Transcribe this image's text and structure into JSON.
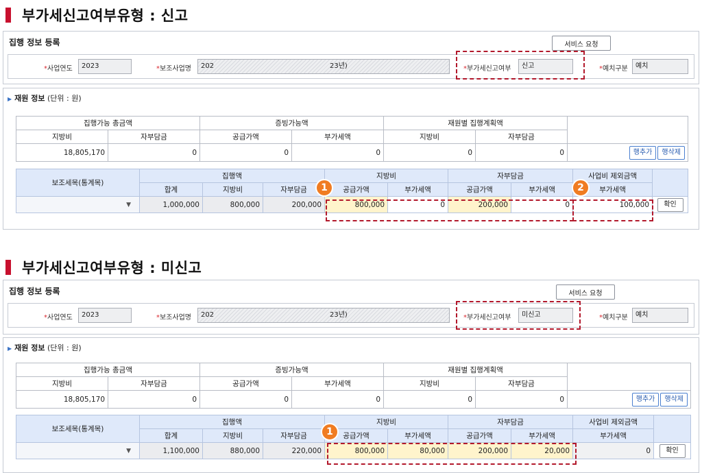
{
  "sections": [
    {
      "headline": "부가세신고여부유형 : 신고",
      "panel_title": "집행 정보 등록",
      "service_button": "서비스 요청",
      "fields": {
        "year_label": "사업연도",
        "year_value": "2023",
        "project_label": "보조사업명",
        "project_value_start": "202",
        "project_value_end": "23년)",
        "vat_label": "부가세신고여부",
        "vat_value": "신고",
        "deposit_label": "예치구분",
        "deposit_value": "예치"
      },
      "fund_title_bold": "재원 정보",
      "fund_title_unit": "(단위 : 원)",
      "summary": {
        "groups": [
          "집행가능 총금액",
          "증빙가능액",
          "재원별 집행계획액"
        ],
        "columns": [
          "지방비",
          "자부담금",
          "공급가액",
          "부가세액",
          "지방비",
          "자부담금"
        ],
        "values": [
          "18,805,170",
          "0",
          "0",
          "0",
          "0",
          "0"
        ],
        "add_row": "행추가",
        "delete_row": "행삭제"
      },
      "detail": {
        "subitem_header": "보조세목(통계목)",
        "exec_header": "집행액",
        "local_header": "지방비",
        "self_header": "자부담금",
        "excluded_header": "사업비 제외금액",
        "sub_headers": [
          "합계",
          "지방비",
          "자부담금",
          "공급가액",
          "부가세액",
          "공급가액",
          "부가세액",
          "부가세액"
        ],
        "values": [
          "1,000,000",
          "800,000",
          "200,000",
          "800,000",
          "0",
          "200,000",
          "0",
          "100,000"
        ],
        "confirm": "확인"
      },
      "badges": [
        "1",
        "2"
      ]
    },
    {
      "headline": "부가세신고여부유형 : 미신고",
      "panel_title": "집행 정보 등록",
      "service_button": "서비스 요청",
      "fields": {
        "year_label": "사업연도",
        "year_value": "2023",
        "project_label": "보조사업명",
        "project_value_start": "202",
        "project_value_end": "23년)",
        "vat_label": "부가세신고여부",
        "vat_value": "미신고",
        "deposit_label": "예치구분",
        "deposit_value": "예치"
      },
      "fund_title_bold": "재원 정보",
      "fund_title_unit": "(단위 : 원)",
      "summary": {
        "groups": [
          "집행가능 총금액",
          "증빙가능액",
          "재원별 집행계획액"
        ],
        "columns": [
          "지방비",
          "자부담금",
          "공급가액",
          "부가세액",
          "지방비",
          "자부담금"
        ],
        "values": [
          "18,805,170",
          "0",
          "0",
          "0",
          "0",
          "0"
        ],
        "add_row": "행추가",
        "delete_row": "행삭제"
      },
      "detail": {
        "subitem_header": "보조세목(통계목)",
        "exec_header": "집행액",
        "local_header": "지방비",
        "self_header": "자부담금",
        "excluded_header": "사업비 제외금액",
        "sub_headers": [
          "합계",
          "지방비",
          "자부담금",
          "공급가액",
          "부가세액",
          "공급가액",
          "부가세액",
          "부가세액"
        ],
        "values": [
          "1,100,000",
          "880,000",
          "220,000",
          "800,000",
          "80,000",
          "200,000",
          "20,000",
          "0"
        ],
        "confirm": "확인"
      },
      "badges": [
        "1"
      ]
    }
  ],
  "colors": {
    "headline_bar": "#c8102e",
    "highlight_dash": "#b2182b",
    "badge": "#f07c22",
    "table_header": "#dfe9fa",
    "highlight_cell": "#fff4cc"
  }
}
